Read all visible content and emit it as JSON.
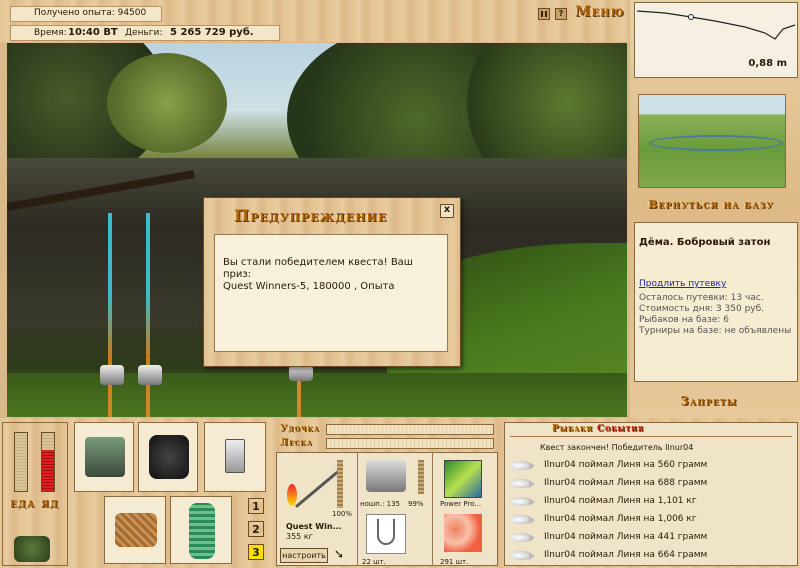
{
  "top": {
    "exp_label": "Получено опыта: 94500",
    "time_label": "Время:",
    "time_value": "10:40 ВТ",
    "money_label": "Деньги:",
    "money_value": "5 265 729 руб.",
    "menu_label": "Меню"
  },
  "depth": {
    "value": "0,88 m"
  },
  "right": {
    "back_to_base": "Вернуться на базу",
    "location_name": "Дёма. Бобровый затон",
    "extend_link": "Продлить путевку",
    "info_lines": [
      "Осталось путевки: 13 час.",
      "Стоимость дня: 3 350 руб.",
      "Рыбаков на базе: 6",
      "Турниры на базе: не объявлены"
    ],
    "bans": "Запреты"
  },
  "dialog": {
    "title": "Предупреждение",
    "close_glyph": "x",
    "message_line1": "Вы стали победителем квеста! Ваш приз:",
    "message_line2": "Quest Winners-5, 180000 , Опыта"
  },
  "meters": {
    "food_label": "ЕДА",
    "bite_label": "ЯД",
    "food_level": 0,
    "bite_level": 0.7
  },
  "bars": {
    "rod_label": "Удочка",
    "line_label": "Леска"
  },
  "tackle": {
    "rod_name": "Quest Win...",
    "rod_weight": "355 кг",
    "rod_pct": "100%",
    "reel_label": "ношп.: 135",
    "reel_pct": "99%",
    "line_name": "Power Pro...",
    "hook_count": "22 шт.",
    "bait_count": "291 шт.",
    "setup_btn": "настроить"
  },
  "slots": {
    "btn1": "1",
    "btn2": "2",
    "btn3": "3"
  },
  "events": {
    "tab_fishers": "Рыбаки",
    "tab_events": "События",
    "header": "Квест закончен! Победитель Ilnur04",
    "rows": [
      "Ilnur04 поймал Линя на 560 грамм",
      "Ilnur04 поймал Линя на 688 грамм",
      "Ilnur04 поймал Линя на 1,101 кг",
      "Ilnur04 поймал Линя на 1,006 кг",
      "Ilnur04 поймал Линя на 441 грамм",
      "Ilnur04 поймал Линя на 664 грамм"
    ]
  }
}
